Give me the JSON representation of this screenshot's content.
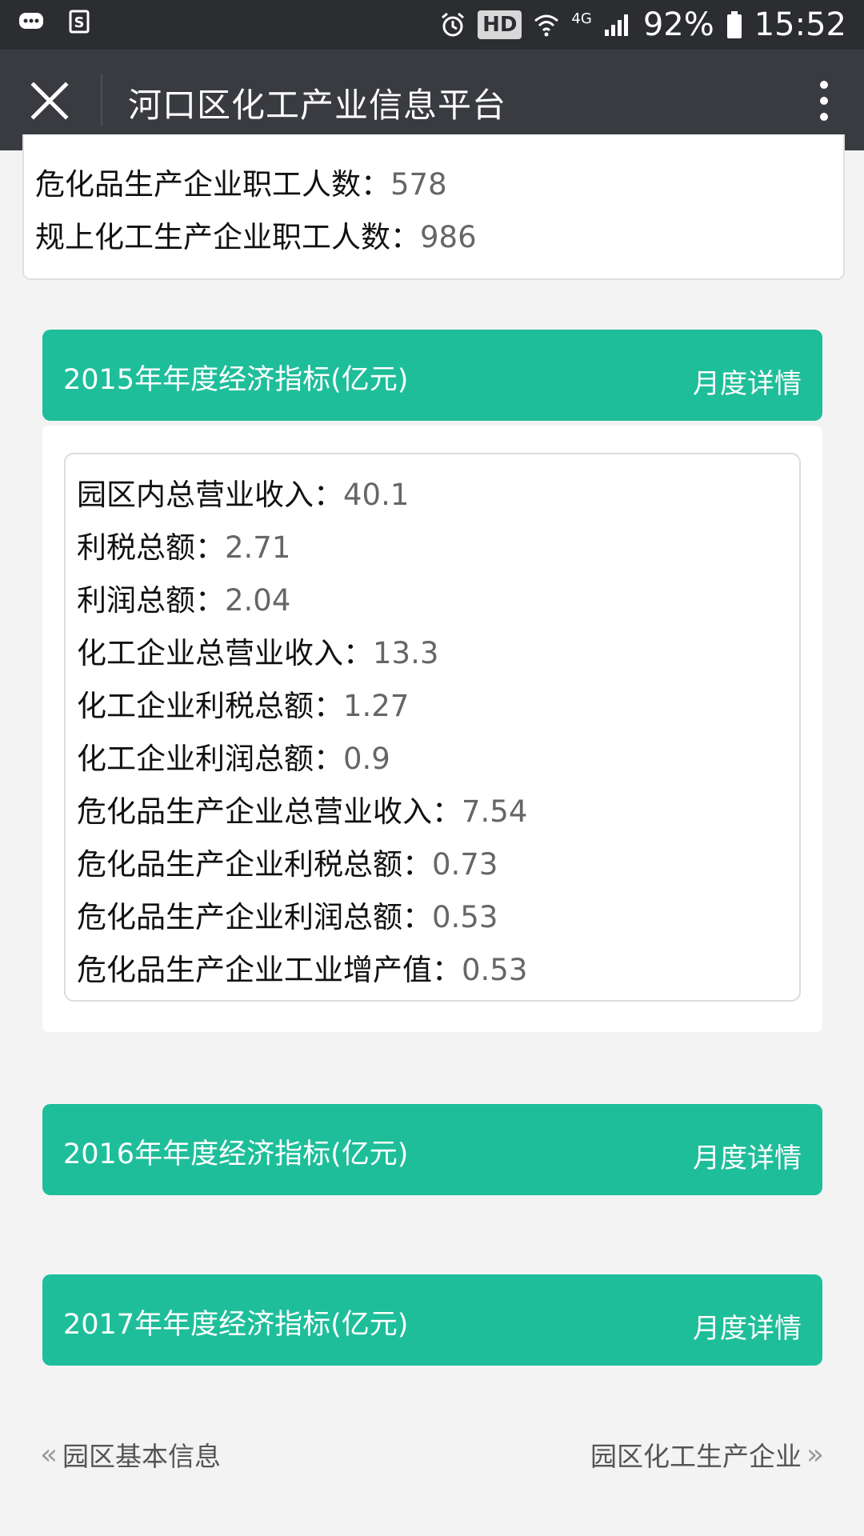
{
  "status_bar": {
    "battery": "92%",
    "time": "15:52",
    "hd": "HD",
    "network": "4G"
  },
  "header": {
    "title": "河口区化工产业信息平台"
  },
  "top_card": {
    "lines": [
      {
        "label": "危化品生产企业职工人数：",
        "value": "578"
      },
      {
        "label": "规上化工生产企业职工人数：",
        "value": "986"
      }
    ]
  },
  "panels": [
    {
      "title": "2015年年度经济指标(亿元)",
      "link": "月度详情",
      "rows": [
        {
          "label": "园区内总营业收入：",
          "value": "40.1"
        },
        {
          "label": "利税总额：",
          "value": "2.71"
        },
        {
          "label": "利润总额：",
          "value": "2.04"
        },
        {
          "label": "化工企业总营业收入：",
          "value": "13.3"
        },
        {
          "label": "化工企业利税总额：",
          "value": "1.27"
        },
        {
          "label": "化工企业利润总额：",
          "value": "0.9"
        },
        {
          "label": "危化品生产企业总营业收入：",
          "value": "7.54"
        },
        {
          "label": "危化品生产企业利税总额：",
          "value": "0.73"
        },
        {
          "label": "危化品生产企业利润总额：",
          "value": "0.53"
        },
        {
          "label": "危化品生产企业工业增产值：",
          "value": "0.53"
        }
      ]
    },
    {
      "title": "2016年年度经济指标(亿元)",
      "link": "月度详情"
    },
    {
      "title": "2017年年度经济指标(亿元)",
      "link": "月度详情"
    }
  ],
  "footer": {
    "prev": "园区基本信息",
    "next": "园区化工生产企业"
  },
  "colors": {
    "accent": "#1fbe9a",
    "titlebar": "#393b40",
    "statusbar": "#2b2d31"
  }
}
